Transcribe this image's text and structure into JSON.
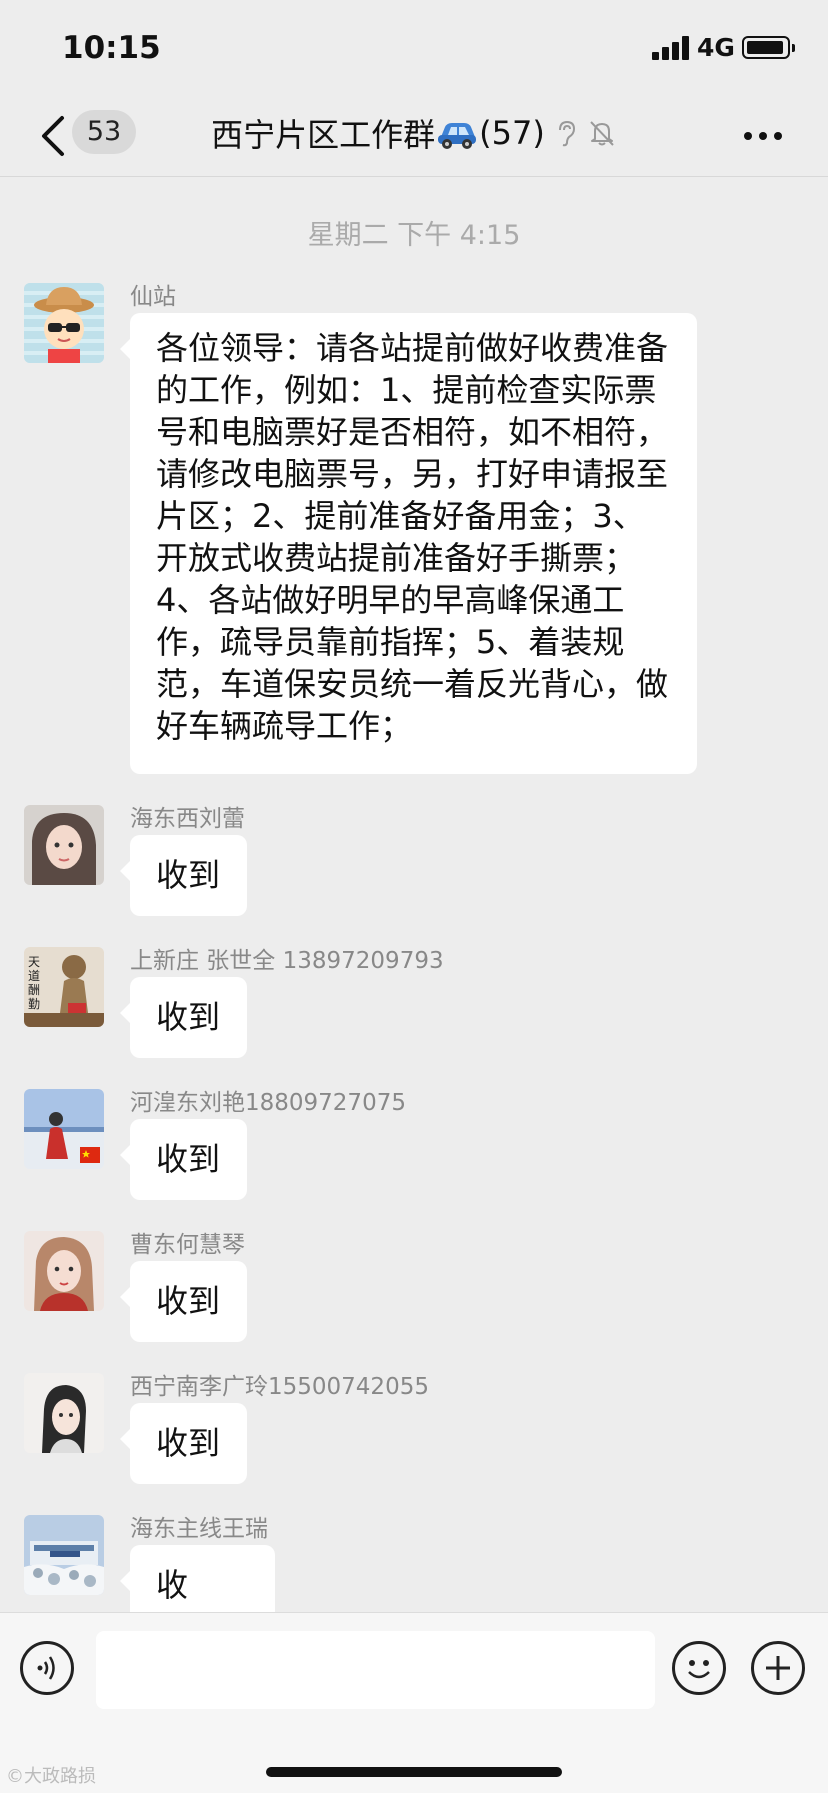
{
  "status": {
    "time": "10:15",
    "network": "4G"
  },
  "nav": {
    "unread_count": "53",
    "title": "西宁片区工作群",
    "member_count": "(57)"
  },
  "timestamp": "星期二 下午 4:15",
  "messages": [
    {
      "sender": "仙站",
      "text": "各位领导：请各站提前做好收费准备的工作，例如：1、提前检查实际票号和电脑票好是否相符，如不相符，请修改电脑票号，另，打好申请报至片区；2、提前准备好备用金；3、开放式收费站提前准备好手撕票；4、各站做好明早的早高峰保通工作，疏导员靠前指挥；5、着装规范，车道保安员统一着反光背心，做好车辆疏导工作；"
    },
    {
      "sender": "海东西刘蕾",
      "text": "收到"
    },
    {
      "sender": "上新庄  张世全  13897209793",
      "text": "收到"
    },
    {
      "sender": "河湟东刘艳18809727075",
      "text": "收到"
    },
    {
      "sender": "曹东何慧琴",
      "text": "收到"
    },
    {
      "sender": "西宁南李广玲15500742055",
      "text": "收到"
    },
    {
      "sender": "海东主线王瑞",
      "text": "收到！"
    }
  ],
  "avatar_text": [
    "天",
    "道",
    "酬",
    "勤"
  ],
  "input": {
    "placeholder": ""
  },
  "watermark": "©大政路损",
  "icons": {
    "back": "chevron-left-icon",
    "car": "car-emoji-icon",
    "ear": "ear-icon",
    "mute": "bell-slash-icon",
    "more": "more-dots-icon",
    "voice": "voice-icon",
    "emoji": "smiley-icon",
    "plus": "plus-icon"
  },
  "colors": {
    "background": "#ededed",
    "bubble": "#ffffff",
    "sender_text": "#888888",
    "timestamp_text": "#aaaaaa"
  }
}
